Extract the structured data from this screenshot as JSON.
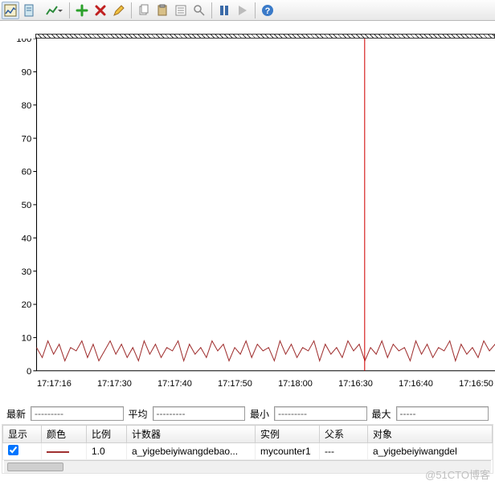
{
  "toolbar": {
    "items": [
      {
        "name": "chart-view",
        "icon": "chart",
        "active": true,
        "drop": false
      },
      {
        "name": "report-view",
        "icon": "page",
        "drop": false
      },
      {
        "name": "chart-type",
        "icon": "line",
        "drop": true
      },
      {
        "name": "separator"
      },
      {
        "name": "add-counter",
        "icon": "plus"
      },
      {
        "name": "remove-counter",
        "icon": "x"
      },
      {
        "name": "highlight",
        "icon": "pencil"
      },
      {
        "name": "separator"
      },
      {
        "name": "copy",
        "icon": "copy"
      },
      {
        "name": "paste",
        "icon": "clipboard"
      },
      {
        "name": "props",
        "icon": "props"
      },
      {
        "name": "zoom",
        "icon": "zoom"
      },
      {
        "name": "separator"
      },
      {
        "name": "pause",
        "icon": "pause"
      },
      {
        "name": "resume",
        "icon": "play"
      },
      {
        "name": "separator"
      },
      {
        "name": "help",
        "icon": "help"
      }
    ]
  },
  "chart_data": {
    "type": "line",
    "ylim": [
      0,
      100
    ],
    "yticks": [
      0,
      10,
      20,
      30,
      40,
      50,
      60,
      70,
      80,
      90,
      100
    ],
    "x_labels": [
      "17:17:16",
      "17:17:30",
      "17:17:40",
      "17:17:50",
      "17:18:00",
      "17:16:30",
      "17:16:40",
      "17:16:50"
    ],
    "series": [
      {
        "name": "a_yigebeiyiwangdebao...",
        "color": "#a03030",
        "values": [
          7,
          4,
          9,
          5,
          8,
          3,
          7,
          6,
          9,
          4,
          8,
          3,
          6,
          9,
          5,
          8,
          4,
          7,
          3,
          9,
          5,
          8,
          4,
          7,
          6,
          9,
          3,
          8,
          5,
          7,
          4,
          9,
          6,
          8,
          3,
          7,
          5,
          9,
          4,
          8,
          6,
          7,
          3,
          9,
          5,
          8,
          4,
          7,
          6,
          9,
          3,
          8,
          5,
          7,
          4,
          9,
          6,
          8,
          3,
          7,
          5,
          9,
          4,
          8,
          6,
          7,
          3,
          9,
          5,
          8,
          4,
          7,
          6,
          9,
          3,
          8,
          5,
          7,
          4,
          9,
          6,
          8,
          3,
          7,
          5
        ]
      }
    ],
    "cursor_fraction": 0.69
  },
  "stats": {
    "latest_label": "最新",
    "latest_value": "---------",
    "avg_label": "平均",
    "avg_value": "---------",
    "min_label": "最小",
    "min_value": "---------",
    "max_label": "最大",
    "max_value": "-----"
  },
  "table": {
    "columns": {
      "show": "显示",
      "color": "颜色",
      "scale": "比例",
      "counter": "计数器",
      "instance": "实例",
      "parent": "父系",
      "object": "对象"
    },
    "rows": [
      {
        "show": true,
        "scale": "1.0",
        "counter": "a_yigebeiyiwangdebao...",
        "instance": "mycounter1",
        "parent": "---",
        "object": "a_yigebeiyiwangdel"
      }
    ]
  },
  "watermark": "@51CTO博客"
}
